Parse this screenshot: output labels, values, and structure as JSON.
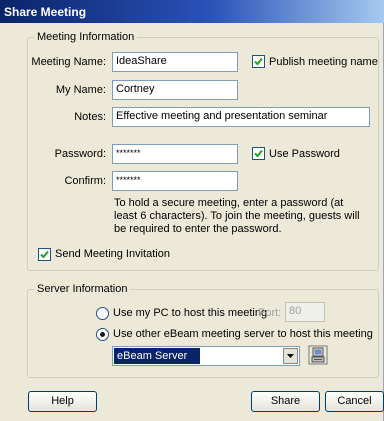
{
  "window": {
    "title": "Share Meeting"
  },
  "meeting_info": {
    "legend": "Meeting Information",
    "meeting_name_label": "Meeting Name:",
    "meeting_name_value": "IdeaShare",
    "publish_label": "Publish meeting name",
    "publish_checked": true,
    "my_name_label": "My Name:",
    "my_name_value": "Cortney",
    "notes_label": "Notes:",
    "notes_value": "Effective meeting and presentation seminar",
    "password_label": "Password:",
    "password_value": "*******",
    "use_password_label": "Use Password",
    "use_password_checked": true,
    "confirm_label": "Confirm:",
    "confirm_value": "*******",
    "password_note": "To hold a secure meeting, enter a password (at least 6 characters). To join the meeting, guests will be required to enter the password.",
    "send_invitation_label": "Send Meeting Invitation",
    "send_invitation_checked": true
  },
  "server_info": {
    "legend": "Server Information",
    "use_my_pc_label": "Use my PC to host this meeting",
    "use_my_pc_selected": false,
    "port_label": "Port:",
    "port_value": "80",
    "use_other_label": "Use other eBeam meeting server to host this meeting",
    "use_other_selected": true,
    "server_selected": "eBeam Server"
  },
  "buttons": {
    "help": "Help",
    "share": "Share",
    "cancel": "Cancel"
  },
  "icons": {
    "server_settings": "server-settings-icon",
    "dropdown_arrow": "chevron-down-icon",
    "checkmark": "checkmark-icon"
  },
  "colors": {
    "title_bar": "#0a246a",
    "selection": "#0a246a",
    "dialog_bg": "#ece9d8",
    "button_border": "#003c74"
  }
}
